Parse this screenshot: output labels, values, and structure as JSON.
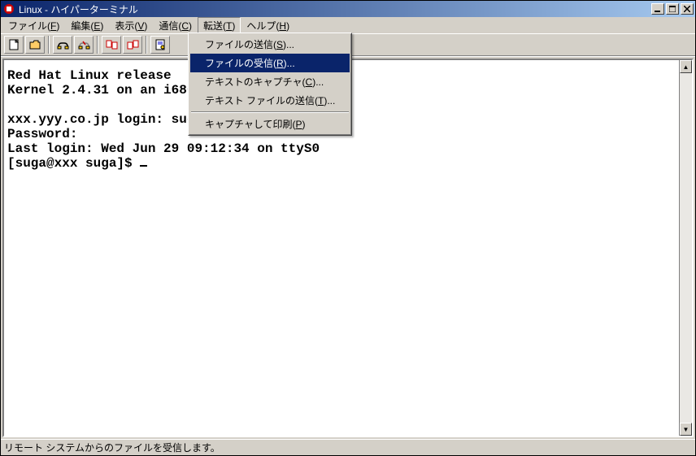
{
  "titlebar": {
    "text": "Linux - ハイパーターミナル"
  },
  "menubar": {
    "file": {
      "label": "ファイル(",
      "accel": "F",
      "suffix": ")"
    },
    "edit": {
      "label": "編集(",
      "accel": "E",
      "suffix": ")"
    },
    "view": {
      "label": "表示(",
      "accel": "V",
      "suffix": ")"
    },
    "comm": {
      "label": "通信(",
      "accel": "C",
      "suffix": ")"
    },
    "transfer": {
      "label": "転送(",
      "accel": "T",
      "suffix": ")"
    },
    "help": {
      "label": "ヘルプ(",
      "accel": "H",
      "suffix": ")"
    }
  },
  "dropdown": {
    "send_file": {
      "label": "ファイルの送信(",
      "accel": "S",
      "suffix": ")..."
    },
    "receive_file": {
      "label": "ファイルの受信(",
      "accel": "R",
      "suffix": ")..."
    },
    "capture_text": {
      "label": "テキストのキャプチャ(",
      "accel": "C",
      "suffix": ")..."
    },
    "send_text": {
      "label": "テキスト ファイルの送信(",
      "accel": "T",
      "suffix": ")..."
    },
    "capture_print": {
      "label": "キャプチャして印刷(",
      "accel": "P",
      "suffix": ")"
    }
  },
  "terminal": {
    "line1": "Red Hat Linux release",
    "line2": "Kernel 2.4.31 on an i686",
    "line3": "",
    "line4": "xxx.yyy.co.jp login: suga",
    "line5": "Password:",
    "line6": "Last login: Wed Jun 29 09:12:34 on ttyS0",
    "line7": "[suga@xxx suga]$ "
  },
  "statusbar": {
    "text": "リモート システムからのファイルを受信します。"
  }
}
